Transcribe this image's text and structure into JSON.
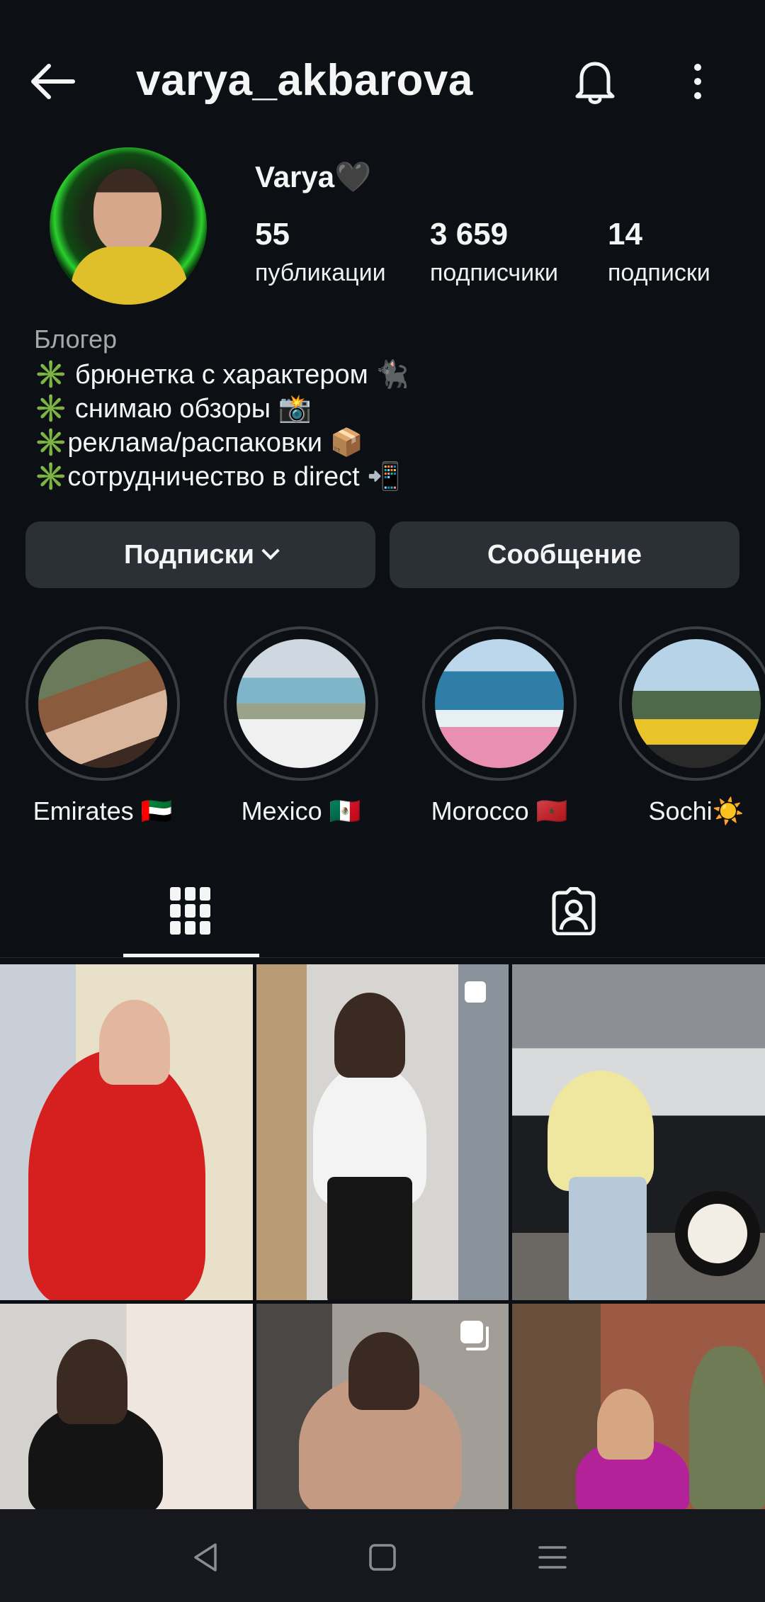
{
  "header": {
    "username": "varya_akbarova",
    "icons": [
      "back-arrow-icon",
      "bell-icon",
      "more-vertical-icon"
    ]
  },
  "profile": {
    "display_name": "Varya🖤",
    "stats": [
      {
        "value": "55",
        "label": "публикации"
      },
      {
        "value": "3 659",
        "label": "подписчики"
      },
      {
        "value": "14",
        "label": "подписки"
      }
    ],
    "category": "Блогер",
    "bio": [
      {
        "bullet": "✳️",
        "text": " брюнетка с характером 🐈‍⬛"
      },
      {
        "bullet": "✳️",
        "text": " снимаю обзоры 📸"
      },
      {
        "bullet": "✳️",
        "text": "реклама/распаковки 📦"
      },
      {
        "bullet": "✳️",
        "text": "сотрудничество в direct 📲"
      }
    ]
  },
  "actions": {
    "following_label": "Подписки",
    "message_label": "Сообщение"
  },
  "highlights": [
    {
      "label": "Emirates 🇦🇪"
    },
    {
      "label": "Mexico 🇲🇽"
    },
    {
      "label": "Morocco 🇲🇦"
    },
    {
      "label": "Sochi☀️"
    }
  ],
  "tabs": [
    {
      "name": "posts-grid",
      "icon": "grid-icon",
      "selected": true
    },
    {
      "name": "tagged",
      "icon": "tagged-person-icon",
      "selected": false
    }
  ],
  "posts": [
    {
      "multi": false
    },
    {
      "multi": true
    },
    {
      "multi": false
    },
    {
      "multi": false
    },
    {
      "multi": true
    },
    {
      "multi": false
    }
  ],
  "nav": [
    "nav-back-icon",
    "nav-home-icon",
    "nav-menu-icon"
  ]
}
